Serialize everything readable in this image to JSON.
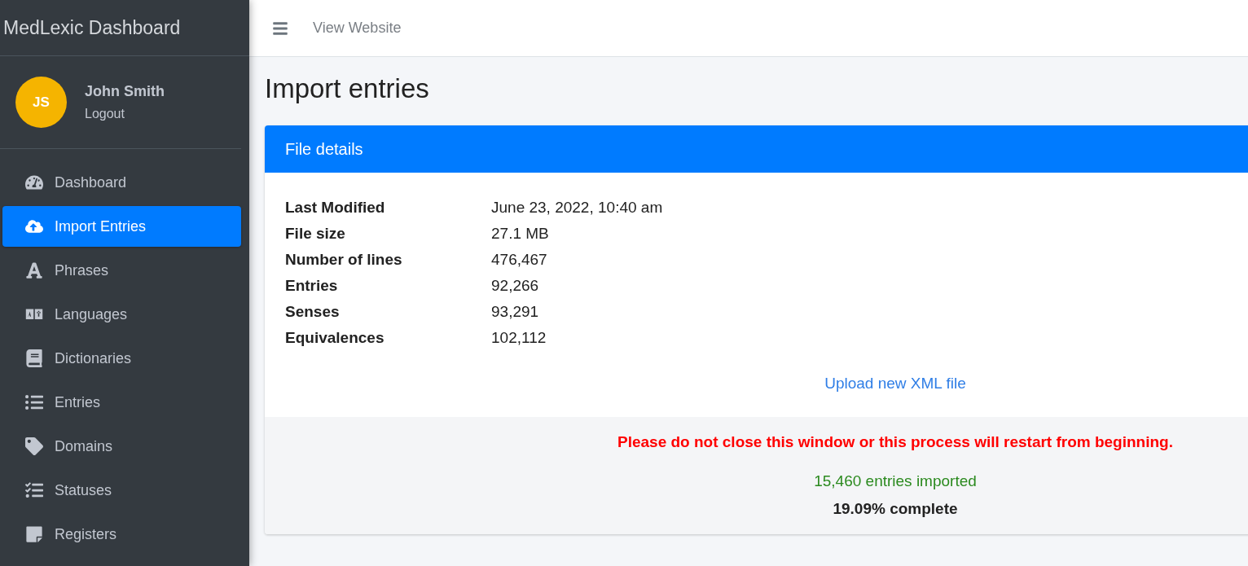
{
  "sidebar": {
    "brand": "MedLexic Dashboard",
    "user": {
      "initials": "JS",
      "name": "John Smith",
      "logout": "Logout"
    },
    "items": [
      {
        "label": "Dashboard",
        "selected": false
      },
      {
        "label": "Import Entries",
        "selected": true
      },
      {
        "label": "Phrases",
        "selected": false
      },
      {
        "label": "Languages",
        "selected": false
      },
      {
        "label": "Dictionaries",
        "selected": false
      },
      {
        "label": "Entries",
        "selected": false
      },
      {
        "label": "Domains",
        "selected": false
      },
      {
        "label": "Statuses",
        "selected": false
      },
      {
        "label": "Registers",
        "selected": false
      }
    ]
  },
  "topbar": {
    "link": "View Website"
  },
  "page_title": "Import entries",
  "card": {
    "header": "File details",
    "details": [
      {
        "label": "Last Modified",
        "value": "June 23, 2022, 10:40 am"
      },
      {
        "label": "File size",
        "value": "27.1 MB"
      },
      {
        "label": "Number of lines",
        "value": "476,467"
      },
      {
        "label": "Entries",
        "value": "92,266"
      },
      {
        "label": "Senses",
        "value": "93,291"
      },
      {
        "label": "Equivalences",
        "value": "102,112"
      }
    ],
    "upload_link": "Upload new XML file",
    "warning": "Please do not close this window or this process will restart from beginning.",
    "imported": "15,460 entries imported",
    "progress": "19.09% complete"
  }
}
